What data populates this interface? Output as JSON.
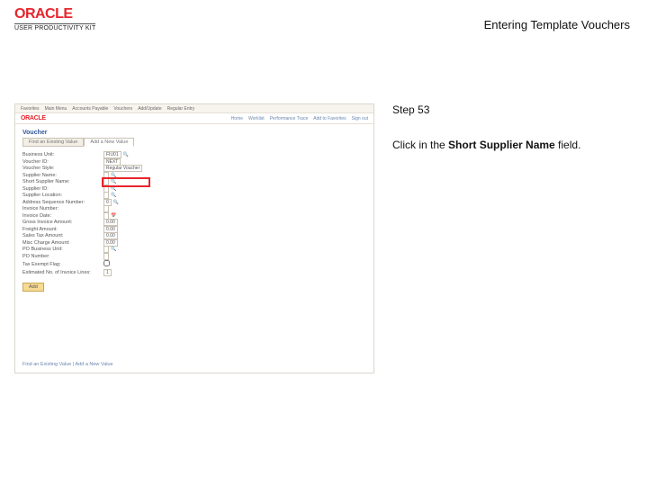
{
  "header": {
    "logo_main": "ORACLE",
    "logo_sub": "USER PRODUCTIVITY KIT",
    "doc_title": "Entering Template Vouchers"
  },
  "instruction": {
    "step_label": "Step 53",
    "text_pre": "Click in the ",
    "text_bold": "Short Supplier Name",
    "text_post": " field."
  },
  "shot": {
    "topbar_items": [
      "Favorites",
      "Main Menu",
      "Accounts Payable",
      "Vouchers",
      "Add/Update",
      "Regular Entry"
    ],
    "mini_logo": "ORACLE",
    "menu_items": [
      "Home",
      "Worklist",
      "Performance Trace",
      "Add to Favorites",
      "Sign out"
    ],
    "page_heading": "Voucher",
    "tab_1": "Find an Existing Value",
    "tab_2": "Add a New Value",
    "fields": {
      "business_unit_lbl": "Business Unit:",
      "business_unit_val": "FIU01",
      "voucher_id_lbl": "Voucher ID:",
      "voucher_id_val": "NEXT",
      "voucher_style_lbl": "Voucher Style:",
      "voucher_style_val": "Regular Voucher",
      "supplier_name_lbl": "Supplier Name:",
      "short_supplier_lbl": "Short Supplier Name:",
      "supplier_id_lbl": "Supplier ID:",
      "supplier_loc_lbl": "Supplier Location:",
      "address_seq_lbl": "Address Sequence Number:",
      "address_seq_val": "0",
      "invoice_num_lbl": "Invoice Number:",
      "invoice_date_lbl": "Invoice Date:",
      "gross_lbl": "Gross Invoice Amount:",
      "gross_val": "0.00",
      "freight_lbl": "Freight Amount:",
      "freight_val": "0.00",
      "sales_tax_lbl": "Sales Tax Amount:",
      "sales_tax_val": "0.00",
      "misc_lbl": "Misc Charge Amount:",
      "misc_val": "0.00",
      "po_bu_lbl": "PO Business Unit:",
      "po_num_lbl": "PO Number:",
      "tax_exempt_lbl": "Tax Exempt Flag:",
      "est_lines_lbl": "Estimated No. of Invoice Lines:",
      "est_lines_val": "1"
    },
    "add_button": "Add",
    "footer": "Find an Existing Value | Add a New Value"
  }
}
